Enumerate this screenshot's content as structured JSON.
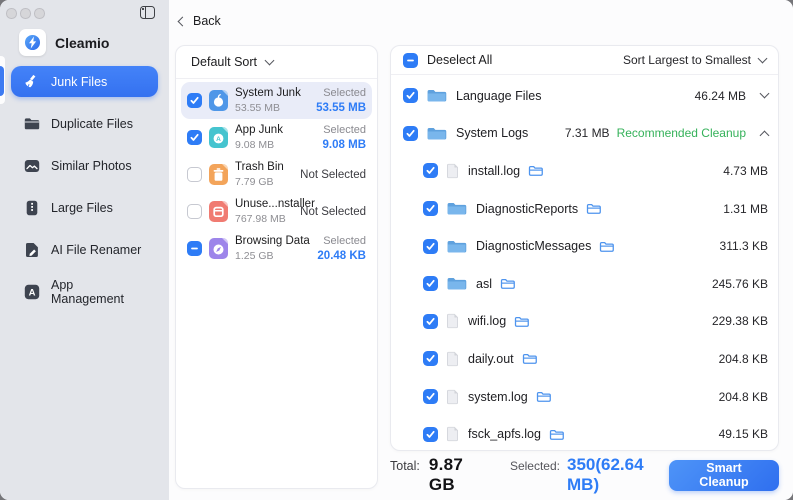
{
  "window": {
    "traffic_lights": [
      "close",
      "minimize",
      "zoom"
    ],
    "sidebar_toggle_icon": "sidebar-toggle-icon"
  },
  "sidebar": {
    "app_name": "Cleamio",
    "logo_icon": "cleamio-logo-icon",
    "items": [
      {
        "label": "Junk Files",
        "icon": "broom-icon",
        "selected": true
      },
      {
        "label": "Duplicate Files",
        "icon": "folder-icon",
        "selected": false
      },
      {
        "label": "Similar Photos",
        "icon": "photos-icon",
        "selected": false
      },
      {
        "label": "Large Files",
        "icon": "stack-icon",
        "selected": false
      },
      {
        "label": "AI File Renamer",
        "icon": "rename-icon",
        "selected": false
      },
      {
        "label": "App Management",
        "icon": "appstore-icon",
        "selected": false
      }
    ]
  },
  "toolbar": {
    "back_label": "Back"
  },
  "categories": {
    "sort_label": "Default Sort",
    "items": [
      {
        "name": "System Junk",
        "size": "53.55 MB",
        "state": "checked",
        "status": "Selected",
        "selected_size": "53.55 MB",
        "highlighted": true,
        "icon": "system-junk-icon",
        "color": "#4F97E8"
      },
      {
        "name": "App Junk",
        "size": "9.08 MB",
        "state": "checked",
        "status": "Selected",
        "selected_size": "9.08 MB",
        "highlighted": false,
        "icon": "app-junk-icon",
        "color": "#45C4CF"
      },
      {
        "name": "Trash Bin",
        "size": "7.79 GB",
        "state": "unchecked",
        "status": "Not Selected",
        "selected_size": "",
        "highlighted": false,
        "icon": "trash-bin-icon",
        "color": "#F3A45A"
      },
      {
        "name": "Unuse...nstaller",
        "size": "767.98 MB",
        "state": "unchecked",
        "status": "Not Selected",
        "selected_size": "",
        "highlighted": false,
        "icon": "uninstaller-icon",
        "color": "#F07B72"
      },
      {
        "name": "Browsing Data",
        "size": "1.25 GB",
        "state": "indeterminate",
        "status": "Selected",
        "selected_size": "20.48 KB",
        "highlighted": false,
        "icon": "browsing-data-icon",
        "color": "#9D85EA"
      }
    ]
  },
  "files": {
    "deselect_all_label": "Deselect All",
    "deselect_state": "indeterminate",
    "sort_label": "Sort Largest to Smallest",
    "rows": [
      {
        "name": "Language Files",
        "size": "46.24 MB",
        "type": "folder",
        "level": 0,
        "state": "checked",
        "expanded": false,
        "tag": "",
        "reveal": false
      },
      {
        "name": "System Logs",
        "size": "7.31 MB",
        "type": "folder",
        "level": 0,
        "state": "checked",
        "expanded": true,
        "tag": "Recommended Cleanup",
        "reveal": false
      },
      {
        "name": "install.log",
        "size": "4.73 MB",
        "type": "file",
        "level": 1,
        "state": "checked",
        "tag": "",
        "reveal": true
      },
      {
        "name": "DiagnosticReports",
        "size": "1.31 MB",
        "type": "folder",
        "level": 1,
        "state": "checked",
        "tag": "",
        "reveal": true
      },
      {
        "name": "DiagnosticMessages",
        "size": "311.3 KB",
        "type": "folder",
        "level": 1,
        "state": "checked",
        "tag": "",
        "reveal": true
      },
      {
        "name": "asl",
        "size": "245.76 KB",
        "type": "folder",
        "level": 1,
        "state": "checked",
        "tag": "",
        "reveal": true
      },
      {
        "name": "wifi.log",
        "size": "229.38 KB",
        "type": "file",
        "level": 1,
        "state": "checked",
        "tag": "",
        "reveal": true
      },
      {
        "name": "daily.out",
        "size": "204.8 KB",
        "type": "file",
        "level": 1,
        "state": "checked",
        "tag": "",
        "reveal": true
      },
      {
        "name": "system.log",
        "size": "204.8 KB",
        "type": "file",
        "level": 1,
        "state": "checked",
        "tag": "",
        "reveal": true
      },
      {
        "name": "fsck_apfs.log",
        "size": "49.15 KB",
        "type": "file",
        "level": 1,
        "state": "checked",
        "tag": "",
        "reveal": true
      }
    ]
  },
  "footer": {
    "total_label": "Total:",
    "total_value": "9.87 GB",
    "selected_label": "Selected:",
    "selected_value": "350(62.64 MB)",
    "cleanup_button": "Smart Cleanup"
  },
  "colors": {
    "accent_blue": "#3471F0",
    "link_blue": "#2E7CF6",
    "recommended_green": "#35B25A",
    "folder_blue": "#79B6EC",
    "sidebar_bg": "#E3E5EA",
    "highlight_row": "#E9ECF8"
  }
}
